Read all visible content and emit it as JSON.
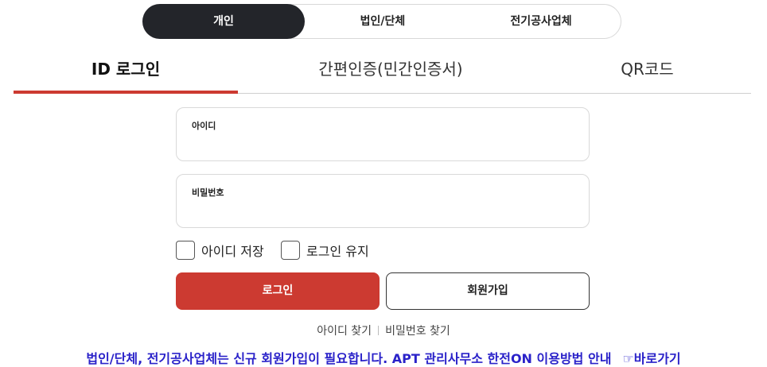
{
  "member_type": {
    "options": [
      "개인",
      "법인/단체",
      "전기공사업체"
    ],
    "selected": "개인"
  },
  "login_tabs": {
    "tabs": [
      "ID 로그인",
      "간편인증(민간인증서)",
      "QR코드"
    ],
    "active": "ID 로그인"
  },
  "form": {
    "id_label": "아이디",
    "id_value": "",
    "password_label": "비밀번호",
    "password_value": ""
  },
  "options": {
    "save_id": "아이디 저장",
    "save_id_checked": false,
    "keep_login": "로그인 유지",
    "keep_login_checked": false
  },
  "buttons": {
    "login": "로그인",
    "join": "회원가입"
  },
  "links": {
    "find_id": "아이디 찾기",
    "find_password": "비밀번호 찾기"
  },
  "notice": {
    "text": "법인/단체, 전기공사업체는 신규 회원가입이 필요합니다. APT 관리사무소 한전ON 이용방법 안내",
    "link": "☞바로가기"
  },
  "colors": {
    "accent": "#cc3a31",
    "segment_active": "#23252a",
    "notice": "#2a22c9"
  }
}
